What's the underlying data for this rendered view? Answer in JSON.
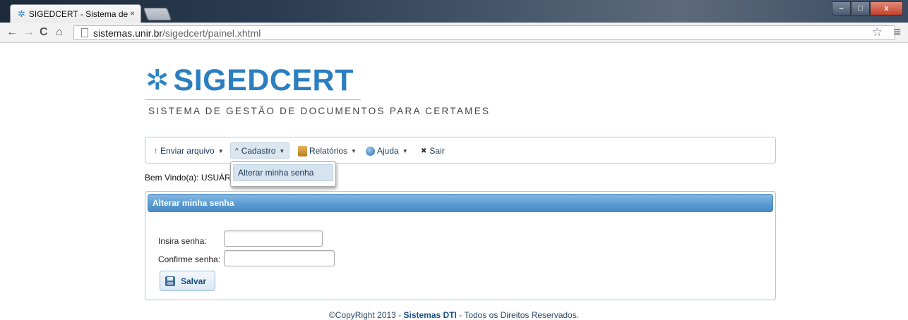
{
  "browser": {
    "tab_title": "SIGEDCERT - Sistema de g",
    "tab_close": "×",
    "url_host": "sistemas.unir.br",
    "url_path": "/sigedcert/painel.xhtml",
    "window_buttons": {
      "minimize": "–",
      "maximize": "□",
      "close": "x"
    }
  },
  "header": {
    "logo_mark": "✲",
    "logo_text": "SIGEDCERT",
    "subtitle": "SISTEMA DE GESTÃO DE DOCUMENTOS PARA CERTAMES"
  },
  "menu": {
    "items": [
      {
        "label": "Enviar arquivo",
        "icon": "↑",
        "icon_name": "upload-arrow-icon",
        "caret": "▼"
      },
      {
        "label": "Cadastro",
        "icon": "^",
        "icon_name": "chevron-up-icon",
        "caret": "▼"
      },
      {
        "label": "Relatórios",
        "icon_name": "reports-icon",
        "caret": "▼"
      },
      {
        "label": "Ajuda",
        "icon_name": "help-icon",
        "caret": "▼"
      },
      {
        "label": "Sair",
        "icon": "✖",
        "icon_name": "close-icon"
      }
    ],
    "dropdown_item": "Alterar minha senha"
  },
  "welcome_text": "Bem Vindo(a): USUÁRIO",
  "panel": {
    "title": "Alterar minha senha",
    "fields": [
      {
        "label": "Insira senha:",
        "value": ""
      },
      {
        "label": "Confirme senha:",
        "value": ""
      }
    ],
    "save_label": "Salvar"
  },
  "footer": {
    "prefix": "©CopyRight 2013 - ",
    "brand": "Sistemas DTI",
    "suffix": " - Todos os Direitos Reservados."
  },
  "colors": {
    "brand": "#2b7fc0",
    "panel_header": "#5b9bd2",
    "menu_border": "#a9cbe6"
  }
}
